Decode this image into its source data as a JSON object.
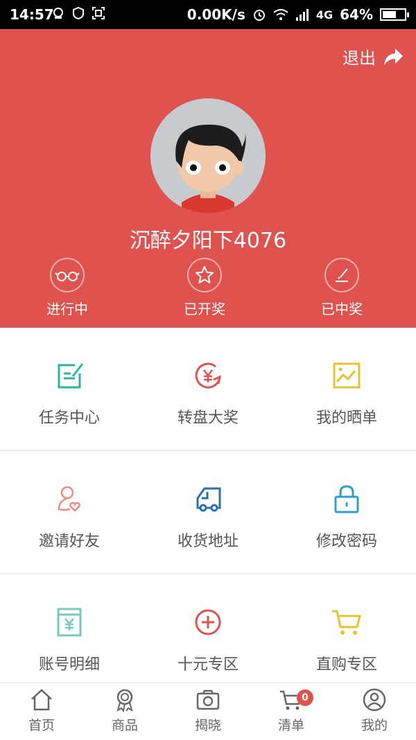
{
  "status_bar": {
    "time": "14:57",
    "network_speed": "0.00K/s",
    "signal_type": "4G",
    "battery": "64%",
    "battery_level": 0.64
  },
  "header": {
    "logout_label": "退出",
    "username": "沉醉夕阳下4076",
    "status_items": [
      {
        "label": "进行中",
        "icon": "glasses-icon"
      },
      {
        "label": "已开奖",
        "icon": "star-icon"
      },
      {
        "label": "已中奖",
        "icon": "pen-icon"
      }
    ]
  },
  "menu": [
    {
      "label": "任务中心",
      "icon": "task-edit-icon",
      "color": "#2bb79d"
    },
    {
      "label": "转盘大奖",
      "icon": "yuan-spin-icon",
      "color": "#e0524d"
    },
    {
      "label": "我的晒单",
      "icon": "image-icon",
      "color": "#e8c12e"
    },
    {
      "label": "邀请好友",
      "icon": "user-heart-icon",
      "color": "#f08a80"
    },
    {
      "label": "收货地址",
      "icon": "truck-icon",
      "color": "#2a6fb0"
    },
    {
      "label": "修改密码",
      "icon": "lock-icon",
      "color": "#2f9ec9"
    },
    {
      "label": "账号明细",
      "icon": "yuan-card-icon",
      "color": "#76c9bd"
    },
    {
      "label": "十元专区",
      "icon": "plus-circle-icon",
      "color": "#e0524d"
    },
    {
      "label": "直购专区",
      "icon": "cart-icon",
      "color": "#e8c12e"
    }
  ],
  "tabs": [
    {
      "label": "首页",
      "icon": "home-icon"
    },
    {
      "label": "商品",
      "icon": "award-icon"
    },
    {
      "label": "揭晓",
      "icon": "camera-icon"
    },
    {
      "label": "清单",
      "icon": "cart-icon",
      "badge": "0"
    },
    {
      "label": "我的",
      "icon": "user-icon"
    }
  ]
}
